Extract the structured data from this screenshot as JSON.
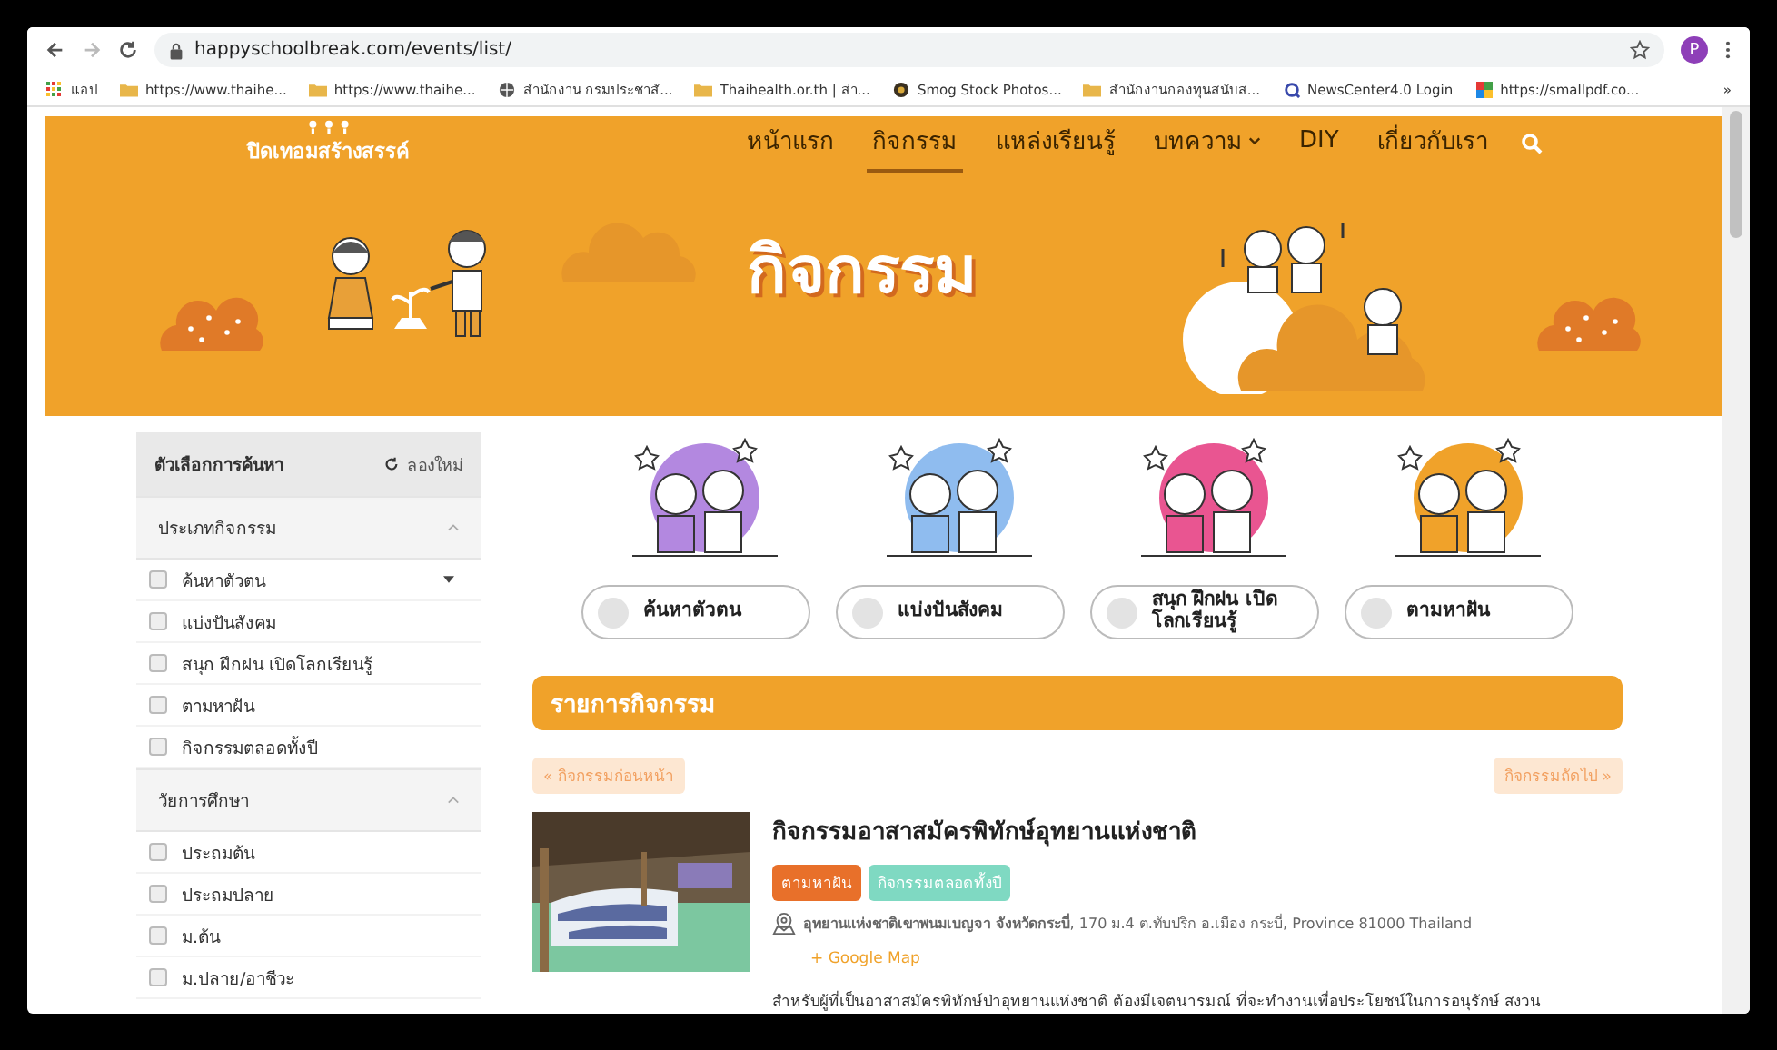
{
  "browser": {
    "url": "happyschoolbreak.com/events/list/",
    "profile_initial": "P",
    "bookmarks": [
      {
        "label": "แอป",
        "kind": "apps"
      },
      {
        "label": "https://www.thaihe...",
        "kind": "folder"
      },
      {
        "label": "https://www.thaihe...",
        "kind": "folder"
      },
      {
        "label": "สำนักงาน กรมประชาสั...",
        "kind": "globe"
      },
      {
        "label": "Thaihealth.or.th | ส่า...",
        "kind": "folder"
      },
      {
        "label": "Smog Stock Photos...",
        "kind": "dot"
      },
      {
        "label": "สำนักงานกองทุนสนับส...",
        "kind": "folder"
      },
      {
        "label": "NewsCenter4.0 Login",
        "kind": "swirl"
      },
      {
        "label": "https://smallpdf.co...",
        "kind": "tiles"
      }
    ],
    "more": "»"
  },
  "site": {
    "logo": "ปิดเทอมสร้างสรรค์",
    "nav": [
      {
        "label": "หน้าแรก",
        "selected": false,
        "dropdown": false
      },
      {
        "label": "กิจกรรม",
        "selected": true,
        "dropdown": false
      },
      {
        "label": "แหล่งเรียนรู้",
        "selected": false,
        "dropdown": false
      },
      {
        "label": "บทความ",
        "selected": false,
        "dropdown": true
      },
      {
        "label": "DIY",
        "selected": false,
        "dropdown": false
      },
      {
        "label": "เกี่ยวกับเรา",
        "selected": false,
        "dropdown": false
      }
    ],
    "hero_title": "กิจกรรม"
  },
  "sidebar": {
    "title": "ตัวเลือกการค้นหา",
    "reset": "ลองใหม่",
    "sections": [
      {
        "title": "ประเภทกิจกรรม",
        "expanded": true,
        "options": [
          {
            "label": "ค้นหาตัวตน",
            "checked": false,
            "dropdown": true
          },
          {
            "label": "แบ่งปันสังคม",
            "checked": false,
            "dropdown": false
          },
          {
            "label": "สนุก ฝึกฝน เปิดโลกเรียนรู้",
            "checked": false,
            "dropdown": false
          },
          {
            "label": "ตามหาฝัน",
            "checked": false,
            "dropdown": false
          },
          {
            "label": "กิจกรรมตลอดทั้งปี",
            "checked": false,
            "dropdown": false
          }
        ]
      },
      {
        "title": "วัยการศึกษา",
        "expanded": true,
        "options": [
          {
            "label": "ประถมต้น",
            "checked": false,
            "dropdown": false
          },
          {
            "label": "ประถมปลาย",
            "checked": false,
            "dropdown": false
          },
          {
            "label": "ม.ต้น",
            "checked": false,
            "dropdown": false
          },
          {
            "label": "ม.ปลาย/อาชีวะ",
            "checked": false,
            "dropdown": false
          }
        ]
      }
    ]
  },
  "categories": [
    {
      "label": "ค้นหาตัวตน",
      "color": "#b388e0",
      "selected": false
    },
    {
      "label": "แบ่งปันสังคม",
      "color": "#8fbcef",
      "selected": false
    },
    {
      "label": "สนุก ฝึกฝน เปิดโลกเรียนรู้",
      "color": "#e95591",
      "selected": false
    },
    {
      "label": "ตามหาฝัน",
      "color": "#f0a22a",
      "selected": false
    }
  ],
  "list": {
    "title": "รายการกิจกรรม",
    "prev": "« กิจกรรมก่อนหน้า",
    "next": "กิจกรรมถัดไป »",
    "event": {
      "title": "กิจกรรมอาสาสมัครพิทักษ์อุทยานแห่งชาติ",
      "tags": [
        {
          "label": "ตามหาฝัน",
          "color": "#e8702a"
        },
        {
          "label": "กิจกรรมตลอดทั้งปี",
          "color": "#7fd9c2"
        }
      ],
      "address": "**อุทยานแห่งชาติเขาพนมเบญจา จังหวัดกระบี่**, 170 ม.4 ต.ทับปริก อ.เมือง กระบี่, Province 81000 Thailand",
      "map_link": "+ Google Map",
      "description": "สำหรับผู้ที่เป็นอาสาสมัครพิทักษ์ป่าอุทยานแห่งชาติ ต้องมีเจตนารมณ์ ที่จะทำงานเพื่อประโยชน์ในการอนุรักษ์ สงวน"
    }
  }
}
